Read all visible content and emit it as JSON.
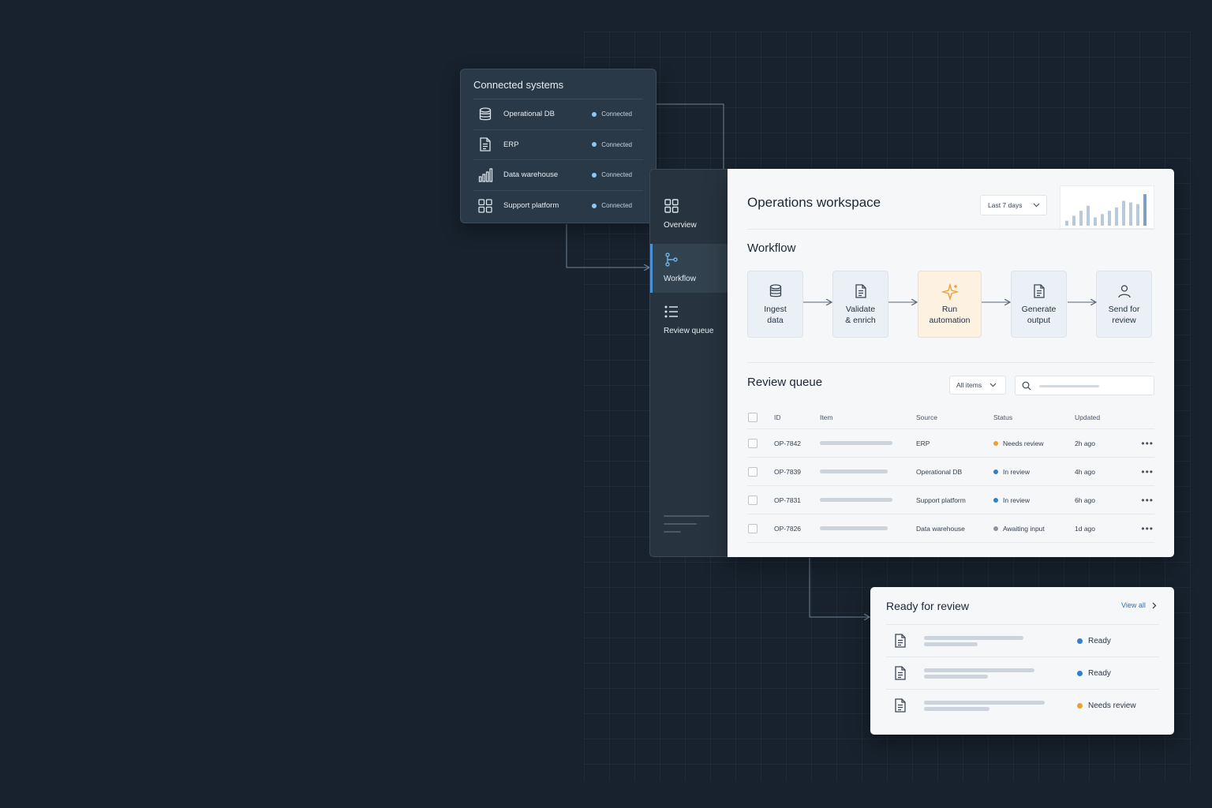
{
  "colors": {
    "accent": "#4a90d9",
    "status_blue": "#2f80d1",
    "status_orange": "#f0a02c",
    "status_gray": "#8a949e",
    "connected_dot": "#8fc6f2"
  },
  "connected_systems": {
    "title": "Connected systems",
    "items": [
      {
        "icon": "database-icon",
        "name": "Operational DB",
        "status": "Connected"
      },
      {
        "icon": "document-icon",
        "name": "ERP",
        "status": "Connected"
      },
      {
        "icon": "bar-chart-icon",
        "name": "Data warehouse",
        "status": "Connected"
      },
      {
        "icon": "grid-icon",
        "name": "Support platform",
        "status": "Connected"
      }
    ]
  },
  "sidebar": {
    "items": [
      {
        "icon": "grid-icon",
        "label": "Overview"
      },
      {
        "icon": "branch-icon",
        "label": "Workflow",
        "active": true
      },
      {
        "icon": "list-icon",
        "label": "Review queue"
      }
    ]
  },
  "workspace": {
    "title": "Operations workspace",
    "date_range": "Last 7 days",
    "sparkline": [
      0.15,
      0.3,
      0.45,
      0.6,
      0.25,
      0.35,
      0.45,
      0.55,
      0.75,
      0.7,
      0.65,
      0.95
    ]
  },
  "workflow": {
    "title": "Workflow",
    "steps": [
      {
        "icon": "database-icon",
        "line1": "Ingest",
        "line2": "data"
      },
      {
        "icon": "document-icon",
        "line1": "Validate",
        "line2": "& enrich"
      },
      {
        "icon": "sparkle-icon",
        "line1": "Run",
        "line2": "automation",
        "highlight": true
      },
      {
        "icon": "document-icon",
        "line1": "Generate",
        "line2": "output"
      },
      {
        "icon": "user-icon",
        "line1": "Send for",
        "line2": "review"
      }
    ]
  },
  "review_queue": {
    "title": "Review queue",
    "filter": "All items",
    "columns": [
      "ID",
      "Item",
      "Source",
      "Status",
      "Updated"
    ],
    "rows": [
      {
        "id": "OP-7842",
        "source": "ERP",
        "status": "Needs review",
        "status_color": "#f0a02c",
        "updated": "2h ago",
        "bar": 0.8
      },
      {
        "id": "OP-7839",
        "source": "Operational DB",
        "status": "In review",
        "status_color": "#2f80d1",
        "updated": "4h ago",
        "bar": 0.75
      },
      {
        "id": "OP-7831",
        "source": "Support platform",
        "status": "In review",
        "status_color": "#2f80d1",
        "updated": "6h ago",
        "bar": 0.8
      },
      {
        "id": "OP-7826",
        "source": "Data warehouse",
        "status": "Awaiting input",
        "status_color": "#8a949e",
        "updated": "1d ago",
        "bar": 0.75
      }
    ]
  },
  "ready_for_review": {
    "title": "Ready for review",
    "view_all": "View all",
    "items": [
      {
        "status": "Ready",
        "status_color": "#2f80d1",
        "bar1": 0.65,
        "bar2": 0.35
      },
      {
        "status": "Ready",
        "status_color": "#2f80d1",
        "bar1": 0.72,
        "bar2": 0.42
      },
      {
        "status": "Needs review",
        "status_color": "#f0a02c",
        "bar1": 0.79,
        "bar2": 0.43
      }
    ]
  }
}
